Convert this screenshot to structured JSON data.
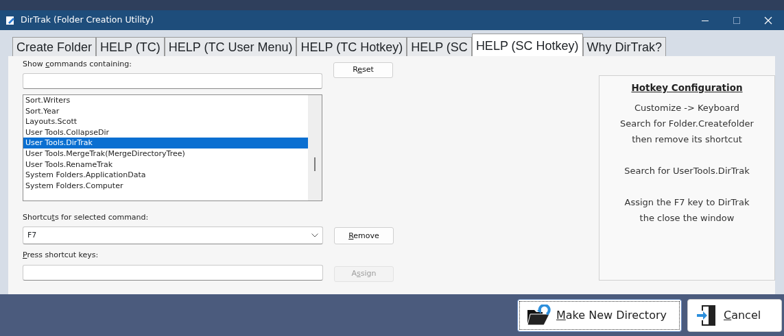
{
  "window": {
    "title": "DirTrak (Folder Creation Utility)"
  },
  "tabs": [
    {
      "label": "Create Folder",
      "selected": false
    },
    {
      "label": "HELP (TC)",
      "selected": false
    },
    {
      "label": "HELP (TC User Menu)",
      "selected": false
    },
    {
      "label": "HELP (TC Hotkey)",
      "selected": false
    },
    {
      "label": "HELP (SC",
      "selected": false
    },
    {
      "label": "HELP (SC Hotkey)",
      "selected": true
    },
    {
      "label": "Why DirTrak?",
      "selected": false
    }
  ],
  "keyboard_dialog": {
    "filter_label": {
      "pre": "Show ",
      "key": "c",
      "post": "ommands containing:"
    },
    "reset_button": {
      "label": {
        "pre": "R",
        "key": "e",
        "post": "set"
      },
      "disabled": false
    },
    "commands": [
      {
        "label": "Sort.Writers",
        "selected": false
      },
      {
        "label": "Sort.Year",
        "selected": false
      },
      {
        "label": "Layouts.Scott",
        "selected": false
      },
      {
        "label": "User Tools.CollapseDir",
        "selected": false
      },
      {
        "label": "User Tools.DirTrak",
        "selected": true
      },
      {
        "label": "User Tools.MergeTrak(MergeDirectoryTree)",
        "selected": false
      },
      {
        "label": "User Tools.RenameTrak",
        "selected": false
      },
      {
        "label": "System Folders.ApplicationData",
        "selected": false
      },
      {
        "label": "System Folders.Computer",
        "selected": false
      }
    ],
    "shortcuts_label": {
      "pre": "Shortcu",
      "key": "t",
      "post": "s for selected command:"
    },
    "shortcut_value": "F7",
    "remove_button": {
      "label": {
        "key": "R",
        "post": "emove"
      },
      "disabled": false
    },
    "press_label": {
      "key": "P",
      "post": "ress shortcut keys:"
    },
    "assign_button": {
      "label": {
        "pre": "A",
        "key": "s",
        "post": "sign"
      },
      "disabled": true
    }
  },
  "help_panel": {
    "heading": "Hotkey Configuration",
    "paragraphs": [
      [
        "Customize -> Keyboard",
        "Search for Folder.Createfolder",
        "then remove its shortcut"
      ],
      [
        "Search for UserTools.DirTrak"
      ],
      [
        "Assign the F7 key to DirTrak",
        "the close the window"
      ]
    ]
  },
  "buttons": [
    {
      "label": {
        "key": "M",
        "post": "ake New Directory"
      },
      "kind": "make",
      "focused": true
    },
    {
      "label": {
        "key": "C",
        "post": "ancel"
      },
      "kind": "cancel",
      "focused": false
    }
  ]
}
